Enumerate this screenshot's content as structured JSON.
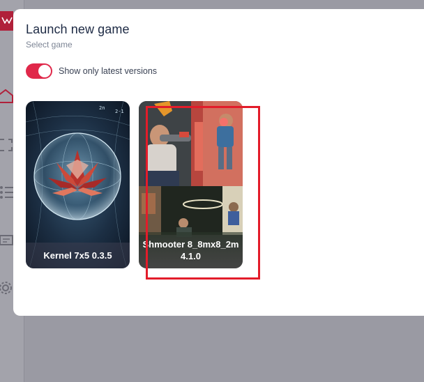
{
  "modal": {
    "title": "Launch new game",
    "subtitle": "Select game",
    "toggle": {
      "label": "Show only latest versions",
      "checked": true
    }
  },
  "games": [
    {
      "label": "Kernel 7x5 0.3.5",
      "image": "crystal-flower-sphere-artwork"
    },
    {
      "label": "Shmooter 8_8mx8_2m 4.1.0",
      "image": "laser-tag-players-collage"
    }
  ],
  "sidebar": {
    "icons": [
      "home-icon",
      "frame-icon",
      "list-icon",
      "display-icon",
      "gear-icon"
    ]
  },
  "colors": {
    "accent": "#e0284a",
    "highlight": "#e31c2a",
    "title": "#1d2a44",
    "overlay": "#9a9aa3"
  }
}
